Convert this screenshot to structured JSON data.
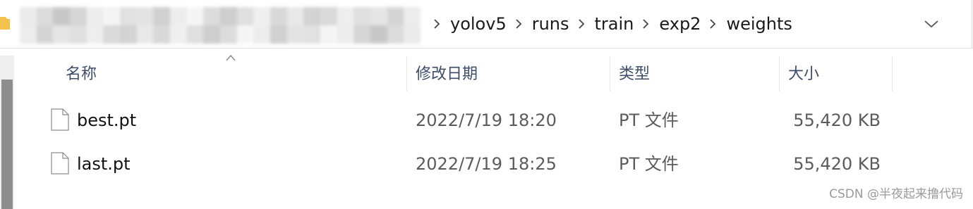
{
  "address_bar": {
    "crumbs": [
      "yolov5",
      "runs",
      "train",
      "exp2",
      "weights"
    ],
    "obscured_colors": [
      "#e9e9e9",
      "#d8d8d8",
      "#c3c3c3",
      "#d2d2d2",
      "#ececec",
      "#f3f3f3",
      "#dedede",
      "#e1e1e1",
      "#cccccc",
      "#ececec",
      "#f5f5f5",
      "#d9d9d9",
      "#c9c9c9",
      "#dcdcdc",
      "#eeeeee",
      "#d4d4d4",
      "#e7e7e7",
      "#cfcfcf",
      "#d6d6d6",
      "#ededed",
      "#dcdcdc",
      "#e3e3e3",
      "#d1d1d1",
      "#eaeaea"
    ]
  },
  "columns": {
    "name": "名称",
    "date": "修改日期",
    "type": "类型",
    "size": "大小"
  },
  "files": [
    {
      "name": "best.pt",
      "date": "2022/7/19 18:20",
      "type": "PT 文件",
      "size": "55,420 KB"
    },
    {
      "name": "last.pt",
      "date": "2022/7/19 18:25",
      "type": "PT 文件",
      "size": "55,420 KB"
    }
  ],
  "watermark": "CSDN @半夜起来撸代码",
  "icons": {
    "folder": "folder-icon",
    "separator": "chevron-right-icon",
    "dropdown": "chevron-down-icon",
    "sort": "sort-ascending-icon",
    "file": "file-icon"
  },
  "colors": {
    "folder": "#f2c14e",
    "header_text": "#3e4d6a",
    "secondary_text": "#5b5b5b"
  }
}
